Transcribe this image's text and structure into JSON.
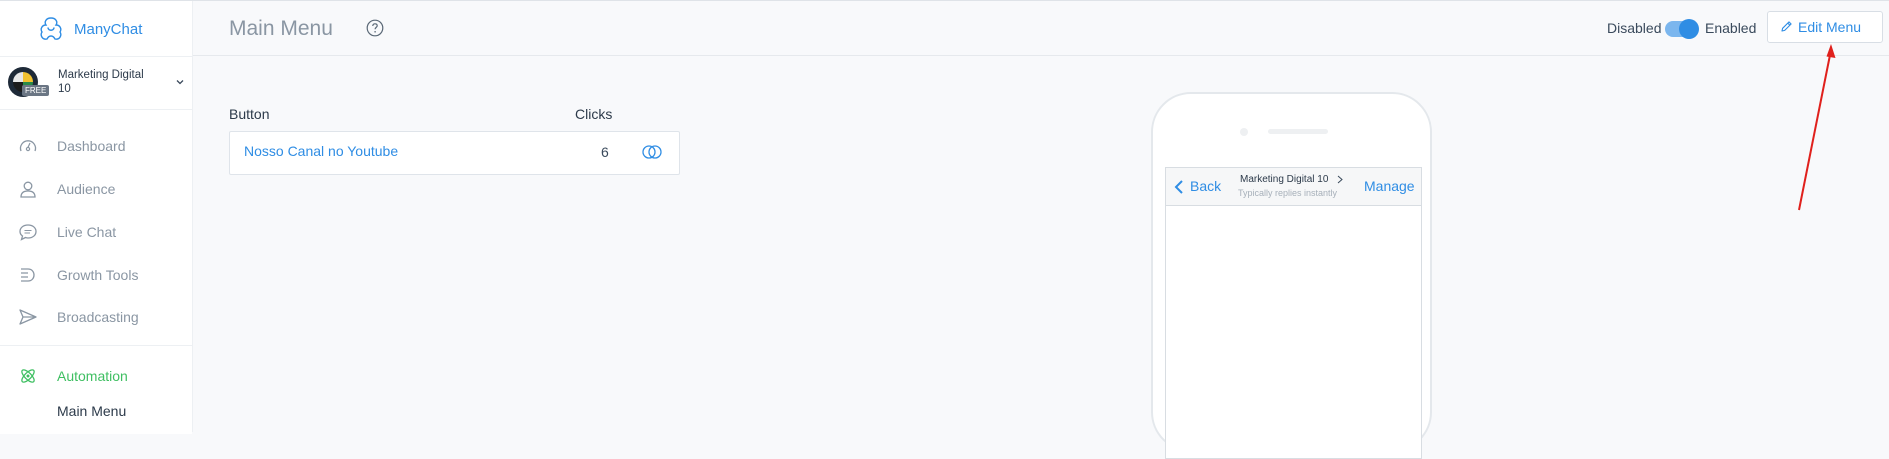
{
  "app": {
    "brand": "ManyChat"
  },
  "account": {
    "name": "Marketing Digital 10",
    "badge": "FREE"
  },
  "sidebar": {
    "items": [
      {
        "label": "Dashboard",
        "icon": "dashboard-gauge-icon"
      },
      {
        "label": "Audience",
        "icon": "person-icon"
      },
      {
        "label": "Live Chat",
        "icon": "chat-bubble-icon"
      },
      {
        "label": "Growth Tools",
        "icon": "growth-tools-icon"
      },
      {
        "label": "Broadcasting",
        "icon": "send-icon"
      }
    ],
    "active": {
      "label": "Automation",
      "icon": "automation-atom-icon",
      "sub": "Main Menu"
    }
  },
  "header": {
    "title": "Main Menu",
    "toggle": {
      "off_label": "Disabled",
      "on_label": "Enabled",
      "state": "enabled"
    },
    "edit_button": "Edit Menu"
  },
  "table": {
    "col_button": "Button",
    "col_clicks": "Clicks",
    "rows": [
      {
        "label": "Nosso Canal no Youtube",
        "clicks": "6"
      }
    ]
  },
  "preview": {
    "back": "Back",
    "page_name": "Marketing Digital 10",
    "status": "Typically replies instantly",
    "manage": "Manage"
  },
  "colors": {
    "accent": "#2f8de4",
    "active": "#3fbf62",
    "annotation": "#e0201c"
  }
}
